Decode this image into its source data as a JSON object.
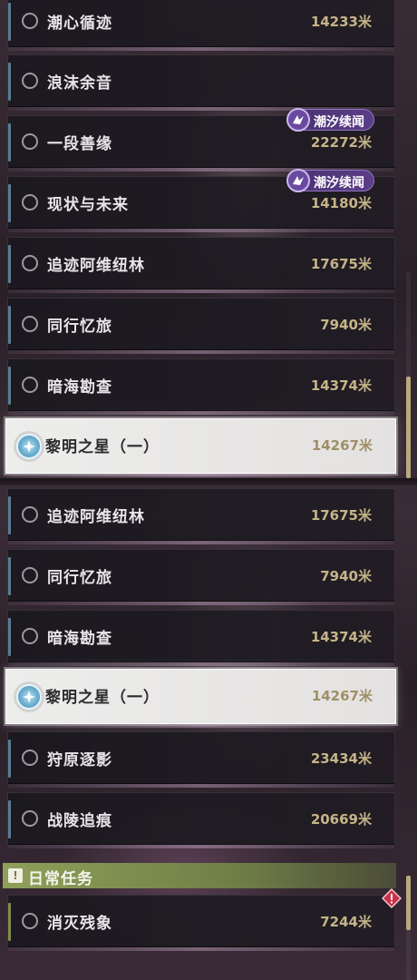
{
  "top_list": [
    {
      "name": "潮心循迹",
      "distance": "14233米"
    },
    {
      "name": "浪沫余音",
      "distance": ""
    },
    {
      "name": "一段善缘",
      "distance": "22272米",
      "badge": "潮汐续闻"
    },
    {
      "name": "现状与未来",
      "distance": "14180米",
      "badge": "潮汐续闻"
    },
    {
      "name": "追迹阿维纽林",
      "distance": "17675米"
    },
    {
      "name": "同行忆旅",
      "distance": "7940米"
    },
    {
      "name": "暗海勘查",
      "distance": "14374米"
    },
    {
      "name": "黎明之星（一）",
      "distance": "14267米",
      "tracked": true
    }
  ],
  "bottom_list": [
    {
      "name": "追迹阿维纽林",
      "distance": "17675米"
    },
    {
      "name": "同行忆旅",
      "distance": "7940米"
    },
    {
      "name": "暗海勘查",
      "distance": "14374米"
    },
    {
      "name": "黎明之星（一）",
      "distance": "14267米",
      "tracked": true
    },
    {
      "name": "狩原逐影",
      "distance": "23434米"
    },
    {
      "name": "战陵追痕",
      "distance": "20669米"
    }
  ],
  "daily_section": {
    "icon": "exclamation-icon",
    "title": "日常任务",
    "color": "#8fa05a",
    "items": [
      {
        "name": "消灭残象",
        "distance": "7244米",
        "alert_icon": "alert-diamond-icon"
      }
    ]
  },
  "colors": {
    "distance": "#c6b488",
    "badge": "#5b3d88",
    "track_icon": "#6aaed0",
    "alert": "#c8334a"
  }
}
